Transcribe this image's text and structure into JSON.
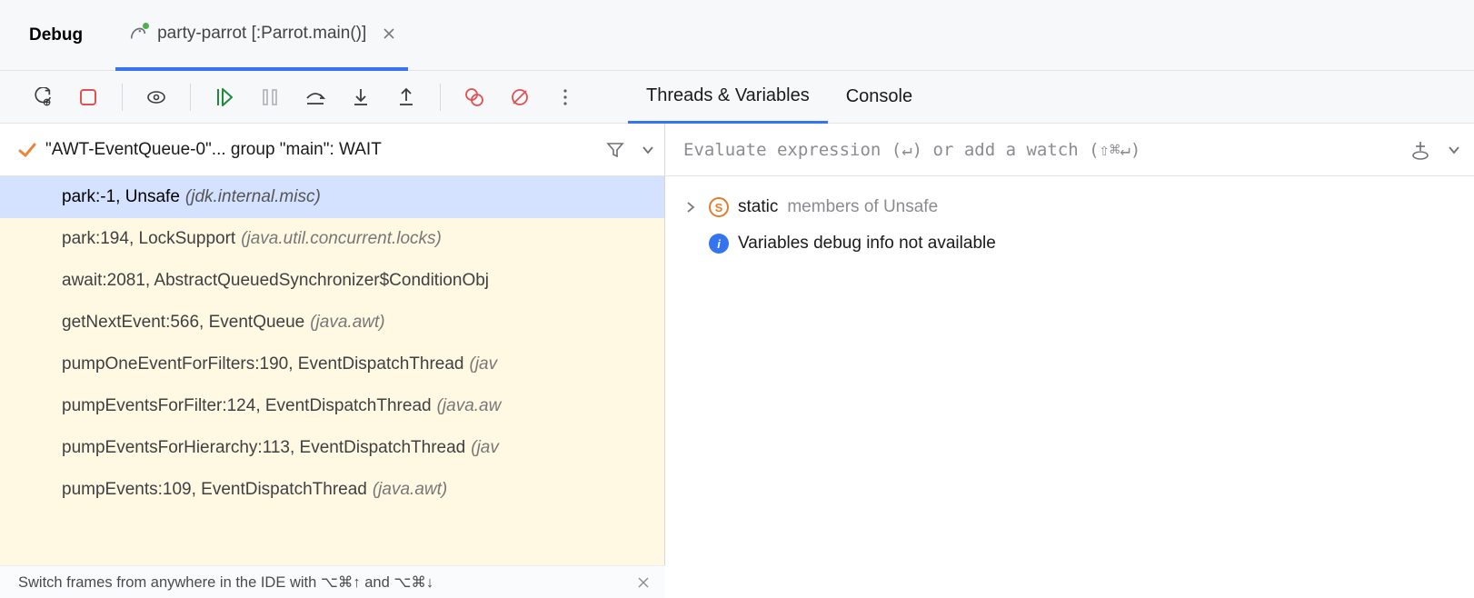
{
  "tabs": {
    "debug_label": "Debug",
    "run_label": "party-parrot [:Parrot.main()]"
  },
  "view_tabs": {
    "threads_vars": "Threads & Variables",
    "console": "Console"
  },
  "thread": {
    "title": "\"AWT-EventQueue-0\"... group \"main\": WAIT"
  },
  "frames": [
    {
      "text": "park:-1, Unsafe",
      "pkg": "(jdk.internal.misc)",
      "selected": true
    },
    {
      "text": "park:194, LockSupport",
      "pkg": "(java.util.concurrent.locks)"
    },
    {
      "text": "await:2081, AbstractQueuedSynchronizer$ConditionObj",
      "pkg": ""
    },
    {
      "text": "getNextEvent:566, EventQueue",
      "pkg": "(java.awt)"
    },
    {
      "text": "pumpOneEventForFilters:190, EventDispatchThread",
      "pkg": "(jav"
    },
    {
      "text": "pumpEventsForFilter:124, EventDispatchThread",
      "pkg": "(java.aw"
    },
    {
      "text": "pumpEventsForHierarchy:113, EventDispatchThread",
      "pkg": "(jav"
    },
    {
      "text": "pumpEvents:109, EventDispatchThread",
      "pkg": "(java.awt)"
    }
  ],
  "watch": {
    "hint": "Evaluate expression (↵) or add a watch (⇧⌘↵)"
  },
  "vars": {
    "static_label": "static",
    "static_suffix": "members of Unsafe",
    "no_debug_info": "Variables debug info not available"
  },
  "tip": {
    "text": "Switch frames from anywhere in the IDE with ⌥⌘↑ and ⌥⌘↓"
  }
}
